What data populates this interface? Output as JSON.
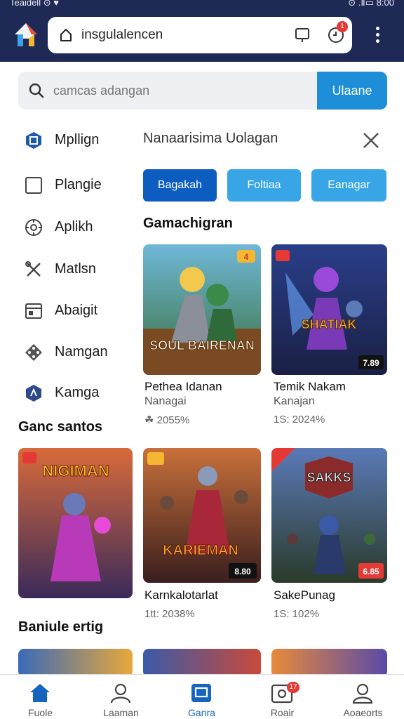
{
  "status_bar": {
    "left": "Teaidell ⊙ ♥",
    "right": "⊙ .Ⅱ▭ 8:00"
  },
  "browser": {
    "url": "insgulalencen",
    "ext_badge": "1"
  },
  "search": {
    "placeholder": "camcas adangan",
    "button": "Ulaane"
  },
  "sidebar": {
    "items": [
      {
        "label": "Mpllign",
        "icon": "app-icon"
      },
      {
        "label": "Plangie",
        "icon": "square-icon"
      },
      {
        "label": "Aplikh",
        "icon": "gear-icon"
      },
      {
        "label": "Matlsn",
        "icon": "tools-icon"
      },
      {
        "label": "Abaigit",
        "icon": "window-icon"
      },
      {
        "label": "Namgan",
        "icon": "gamepad-icon"
      },
      {
        "label": "Kamga",
        "icon": "shield-icon"
      }
    ]
  },
  "panel": {
    "title": "Nanaarisima Uolagan",
    "filters": [
      "Bagakah",
      "Foltiaa",
      "Eanagar"
    ],
    "section1": "Gamachigran",
    "section2": "Ganc santos",
    "section3": "Baniule ertig",
    "row1": [
      {
        "art": "SOUL BAIRENAN",
        "badge": "4",
        "title": "Pethea Idanan",
        "subtitle": "Nanagai",
        "stat": "☘ 2055%"
      },
      {
        "art": "SHATIAK",
        "badge": "7.89",
        "title": "Temik Nakam",
        "subtitle": "Kanajan",
        "stat": "1S: 2024%"
      }
    ],
    "row2": [
      {
        "art": "NIGIMAN",
        "badge": "",
        "title": "",
        "subtitle": "",
        "stat": ""
      },
      {
        "art": "KARIEMAN",
        "badge": "8.80",
        "title": "Karnkalotarlat",
        "subtitle": "",
        "stat": "1tt: 2038%"
      },
      {
        "art": "SAKKS",
        "badge": "6.85",
        "title": "SakePunag",
        "subtitle": "",
        "stat": "1S: 102%"
      }
    ]
  },
  "bottom_nav": [
    {
      "label": "Fuole",
      "icon": "home-icon",
      "active": true
    },
    {
      "label": "Laaman",
      "icon": "person-icon",
      "active": false
    },
    {
      "label": "Ganra",
      "icon": "games-icon",
      "active": true
    },
    {
      "label": "Roair",
      "icon": "inbox-icon",
      "active": false,
      "badge": "17"
    },
    {
      "label": "Aoaeorts",
      "icon": "account-icon",
      "active": false
    }
  ],
  "colors": {
    "appbar": "#1e2a55",
    "accent": "#1e8ed8",
    "primary_button": "#0d5cc0",
    "light_button": "#38a6e6"
  }
}
